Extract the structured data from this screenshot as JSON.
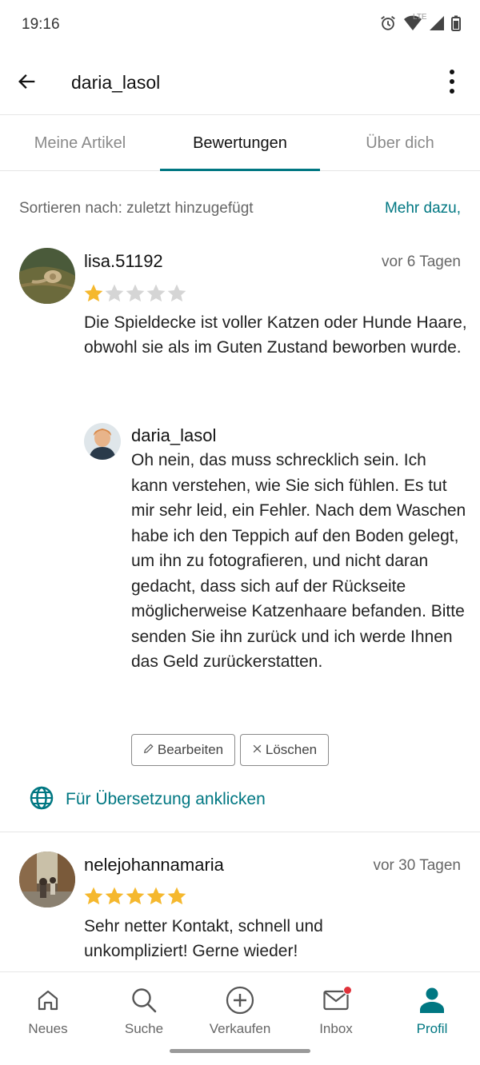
{
  "status_bar": {
    "time": "19:16",
    "network": "LTE"
  },
  "app_bar": {
    "title": "daria_lasol"
  },
  "tabs": [
    {
      "label": "Meine Artikel",
      "active": false
    },
    {
      "label": "Bewertungen",
      "active": true
    },
    {
      "label": "Über dich",
      "active": false
    }
  ],
  "sort": {
    "label": "Sortieren nach: zuletzt hinzugefügt",
    "more_link": "Mehr dazu,"
  },
  "reviews": [
    {
      "name": "lisa.51192",
      "date": "vor 6 Tagen",
      "rating": 1,
      "max_rating": 5,
      "text": "Die Spieldecke ist voller Katzen oder Hunde Haare, obwohl sie als im Guten Zustand beworben wurde.",
      "reply": {
        "name": "daria_lasol",
        "text": "Oh nein, das muss schrecklich sein. Ich kann verstehen, wie Sie sich fühlen. Es tut mir sehr leid, ein Fehler. Nach dem Waschen habe ich den Teppich auf den Boden gelegt, um ihn zu fotografieren, und nicht daran gedacht, dass sich auf der Rückseite möglicherweise Katzenhaare befanden. Bitte senden Sie ihn zurück und ich werde Ihnen das Geld zurückerstatten.",
        "edit_label": "Bearbeiten",
        "delete_label": "Löschen"
      },
      "translate_label": "Für Übersetzung anklicken"
    },
    {
      "name": "nelejohannamaria",
      "date": "vor 30 Tagen",
      "rating": 5,
      "max_rating": 5,
      "text": "Sehr netter Kontakt, schnell und unkompliziert! Gerne wieder!"
    }
  ],
  "bottom_nav": [
    {
      "label": "Neues",
      "icon": "home-icon",
      "active": false
    },
    {
      "label": "Suche",
      "icon": "search-icon",
      "active": false
    },
    {
      "label": "Verkaufen",
      "icon": "plus-circle-icon",
      "active": false
    },
    {
      "label": "Inbox",
      "icon": "mail-icon",
      "active": false,
      "badge": true
    },
    {
      "label": "Profil",
      "icon": "person-icon",
      "active": true
    }
  ],
  "colors": {
    "accent": "#007782",
    "star": "#f5b82e",
    "star_empty": "#d5d5d5",
    "badge": "#e0313a"
  }
}
